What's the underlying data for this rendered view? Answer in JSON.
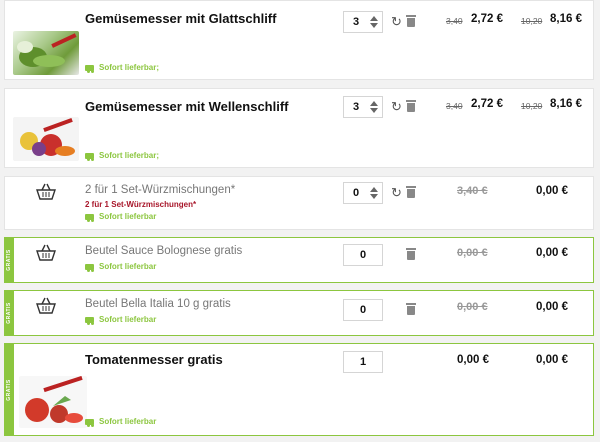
{
  "cart": {
    "items": [
      {
        "title": "Gemüsemesser mit Glattschliff",
        "availability": "Sofort lieferbar;",
        "quantity": "3",
        "unit_old": "3,40",
        "unit_price": "2,72 €",
        "total_old": "10,20",
        "total_price": "8,16 €"
      },
      {
        "title": "Gemüsemesser mit Wellenschliff",
        "availability": "Sofort lieferbar;",
        "quantity": "3",
        "unit_old": "3,40",
        "unit_price": "2,72 €",
        "total_old": "10,20",
        "total_price": "8,16 €"
      },
      {
        "title": "2 für 1 Set-Würzmischungen*",
        "subtitle": "2 für 1 Set-Würzmischungen*",
        "availability": "Sofort lieferbar",
        "quantity": "0",
        "unit_old": "3,40 €",
        "total_price": "0,00 €"
      },
      {
        "badge": "GRATIS",
        "title": "Beutel Sauce Bolognese gratis",
        "availability": "Sofort lieferbar",
        "quantity": "0",
        "unit_old": "0,00 €",
        "total_price": "0,00 €"
      },
      {
        "badge": "GRATIS",
        "title": "Beutel Bella Italia 10 g gratis",
        "availability": "Sofort lieferbar",
        "quantity": "0",
        "unit_old": "0,00 €",
        "total_price": "0,00 €"
      },
      {
        "badge": "GRATIS",
        "title": "Tomatenmesser gratis",
        "availability": "Sofort lieferbar",
        "quantity": "1",
        "unit_price": "0,00 €",
        "total_price": "0,00 €"
      }
    ]
  },
  "icons": {
    "refresh": "refresh-icon",
    "trash": "trash-icon",
    "truck": "truck-icon",
    "basket": "basket-icon"
  },
  "colors": {
    "accent_green": "#8cc63f",
    "promo_red": "#a8162a"
  }
}
